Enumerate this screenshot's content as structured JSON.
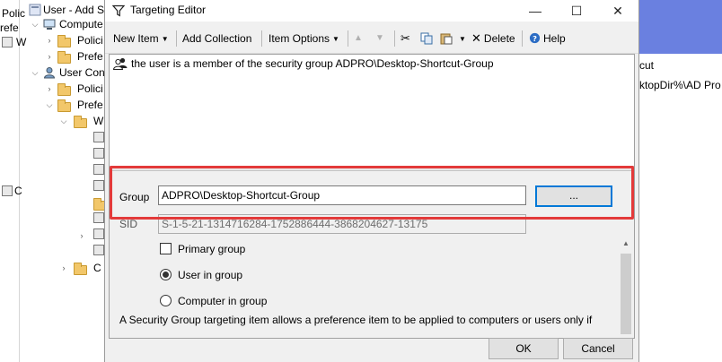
{
  "tree": {
    "items": [
      {
        "label": "Polic",
        "level": 0
      },
      {
        "label": "refe",
        "level": 0
      },
      {
        "label": "W",
        "level": 1
      },
      {
        "label": "C",
        "level": 0
      },
      {
        "label": "User - Add S",
        "level": 0
      },
      {
        "label": "Compute",
        "level": 1
      },
      {
        "label": "Polici",
        "level": 2
      },
      {
        "label": "Prefe",
        "level": 2
      },
      {
        "label": "User Con",
        "level": 1
      },
      {
        "label": "Polici",
        "level": 2
      },
      {
        "label": "Prefe",
        "level": 2
      },
      {
        "label": "W",
        "level": 3
      },
      {
        "label": "C",
        "level": 3
      }
    ]
  },
  "bg_window": {
    "line1": "cut",
    "line2": "ktopDir%\\AD Pro"
  },
  "dialog": {
    "title": "Targeting Editor",
    "window_buttons": {
      "minimize": "—",
      "maximize": "☐",
      "close": "✕"
    },
    "toolbar": {
      "new_item": "New Item",
      "add_collection": "Add Collection",
      "item_options": "Item Options",
      "delete": "Delete",
      "help": "Help"
    },
    "targeting_item": "the user is a member of the security group ADPRO\\Desktop-Shortcut-Group",
    "properties": {
      "group_label": "Group",
      "group_value": "ADPRO\\Desktop-Shortcut-Group",
      "browse_label": "...",
      "sid_label": "SID",
      "sid_value": "S-1-5-21-1314716284-1752886444-3868204627-13175",
      "primary_group_label": "Primary group",
      "primary_group_checked": false,
      "user_in_group_label": "User in group",
      "computer_in_group_label": "Computer in group",
      "selected_option": "user_in_group",
      "description": "A Security Group targeting item allows a preference item to be applied to computers or users only if"
    },
    "ok_label": "OK",
    "cancel_label": "Cancel"
  },
  "colors": {
    "highlight": "#e33a3a",
    "focus_border": "#0078d7",
    "bg_window_blue": "#6a80e0",
    "dialog_bg": "#f0f0f0"
  }
}
